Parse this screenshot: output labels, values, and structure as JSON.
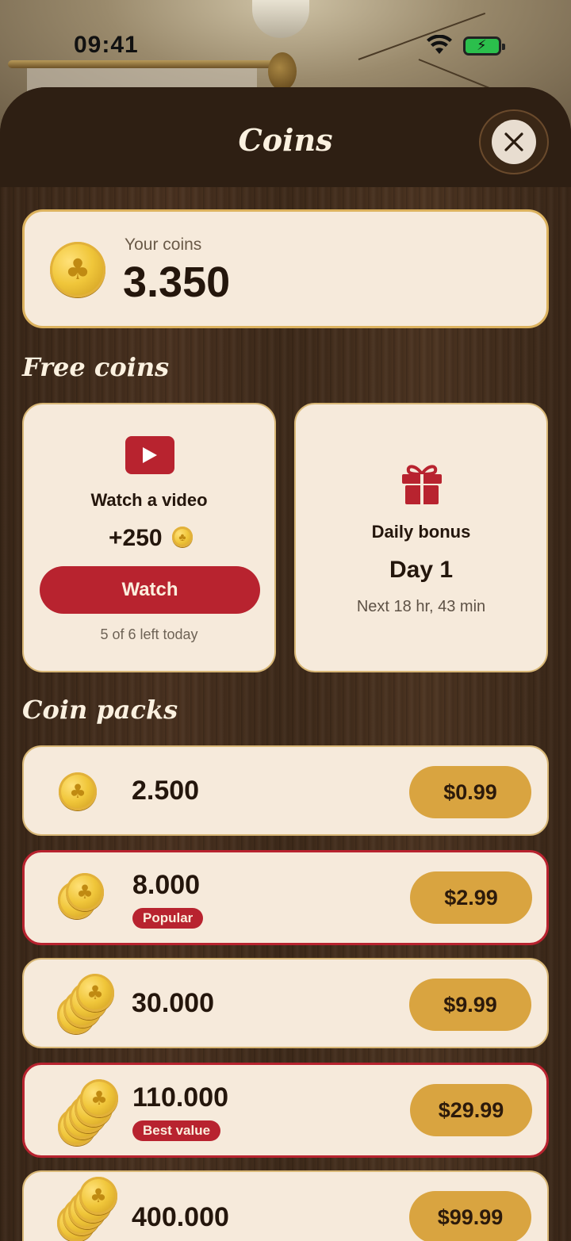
{
  "status_bar": {
    "time": "09:41"
  },
  "sheet": {
    "title": "Coins"
  },
  "balance": {
    "label": "Your coins",
    "value": "3.350"
  },
  "free_coins": {
    "title": "Free coins",
    "video": {
      "label": "Watch a video",
      "reward": "+250",
      "button_label": "Watch",
      "remaining": "5 of 6 left today"
    },
    "daily": {
      "label": "Daily bonus",
      "day": "Day 1",
      "next": "Next 18 hr, 43 min"
    }
  },
  "coin_packs": {
    "title": "Coin packs",
    "items": [
      {
        "amount": "2.500",
        "price": "$0.99",
        "badge": ""
      },
      {
        "amount": "8.000",
        "price": "$2.99",
        "badge": "Popular"
      },
      {
        "amount": "30.000",
        "price": "$9.99",
        "badge": ""
      },
      {
        "amount": "110.000",
        "price": "$29.99",
        "badge": "Best value"
      },
      {
        "amount": "400.000",
        "price": "$99.99",
        "badge": ""
      }
    ]
  },
  "colors": {
    "accent_red": "#b8232f",
    "gold": "#d9a440",
    "card_bg": "#f6eadb",
    "wood_dark": "#2e1f13"
  }
}
